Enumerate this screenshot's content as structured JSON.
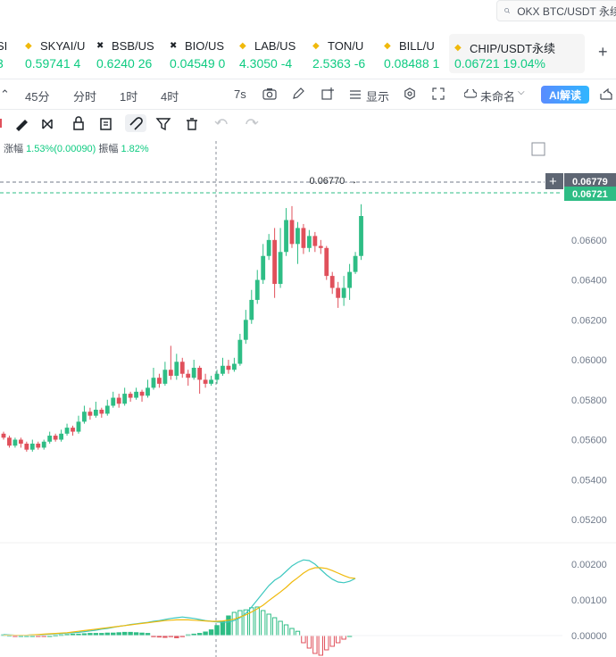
{
  "search": {
    "placeholder": "OKX BTC/USDT 永续"
  },
  "tickers": [
    {
      "name": "SI",
      "price": "3"
    },
    {
      "name": "SKYAI/U",
      "price": "0.59741 4"
    },
    {
      "name": "BSB/US",
      "price": "0.6240 26"
    },
    {
      "name": "BIO/US",
      "price": "0.04549 0"
    },
    {
      "name": "LAB/US",
      "price": "4.3050 -4"
    },
    {
      "name": "TON/U",
      "price": "2.5363 -6"
    },
    {
      "name": "BILL/U",
      "price": "0.08488 1"
    },
    {
      "name": "CHIP/USDT永续",
      "price": "0.06721  19.04%"
    }
  ],
  "toolbar": {
    "intervals": [
      "45分",
      "分时",
      "1时",
      "4时"
    ],
    "seconds": "7s",
    "display_label": "显示",
    "layout_name": "未命名",
    "ai_label": "AI解读"
  },
  "stats": {
    "change_label": "涨幅",
    "change_value": "1.53%(0.00090)",
    "amplitude_label": "振幅",
    "amplitude_value": "1.82%"
  },
  "chart_data": {
    "type": "candlestick",
    "price_axis_ticks": [
      "0.06600",
      "0.06400",
      "0.06200",
      "0.06000",
      "0.05800",
      "0.05600",
      "0.05400",
      "0.05200"
    ],
    "macd_axis_ticks": [
      "0.00200",
      "0.00100",
      "0.00000"
    ],
    "high_marker": "0.06770",
    "crosshair_price": "0.06779",
    "last_price": "0.06721",
    "candles": [
      [
        0.0563,
        0.0561,
        0.0564,
        0.056
      ],
      [
        0.0561,
        0.0557,
        0.0562,
        0.0556
      ],
      [
        0.0557,
        0.056,
        0.0561,
        0.0556
      ],
      [
        0.056,
        0.0558,
        0.0561,
        0.0556
      ],
      [
        0.0558,
        0.0555,
        0.0559,
        0.0554
      ],
      [
        0.0555,
        0.0558,
        0.056,
        0.0554
      ],
      [
        0.0558,
        0.0556,
        0.0559,
        0.0555
      ],
      [
        0.0556,
        0.0559,
        0.056,
        0.0555
      ],
      [
        0.0559,
        0.0562,
        0.0564,
        0.0558
      ],
      [
        0.0562,
        0.056,
        0.0563,
        0.0559
      ],
      [
        0.056,
        0.0563,
        0.0565,
        0.0559
      ],
      [
        0.0563,
        0.0566,
        0.0568,
        0.0562
      ],
      [
        0.0566,
        0.0564,
        0.0567,
        0.0562
      ],
      [
        0.0564,
        0.0569,
        0.0572,
        0.0563
      ],
      [
        0.0569,
        0.0574,
        0.0577,
        0.0568
      ],
      [
        0.0574,
        0.0572,
        0.0576,
        0.057
      ],
      [
        0.0572,
        0.0575,
        0.0579,
        0.0571
      ],
      [
        0.0575,
        0.0573,
        0.0576,
        0.0571
      ],
      [
        0.0573,
        0.0577,
        0.058,
        0.0572
      ],
      [
        0.0577,
        0.0581,
        0.0584,
        0.0576
      ],
      [
        0.0581,
        0.0578,
        0.0583,
        0.0576
      ],
      [
        0.0578,
        0.0583,
        0.0586,
        0.0577
      ],
      [
        0.0583,
        0.0581,
        0.0584,
        0.0579
      ],
      [
        0.0581,
        0.0584,
        0.0586,
        0.058
      ],
      [
        0.0584,
        0.0582,
        0.0585,
        0.0579
      ],
      [
        0.0582,
        0.0586,
        0.059,
        0.0581
      ],
      [
        0.0586,
        0.0591,
        0.0596,
        0.0585
      ],
      [
        0.0591,
        0.0588,
        0.0593,
        0.0586
      ],
      [
        0.0588,
        0.0595,
        0.0599,
        0.0587
      ],
      [
        0.0595,
        0.0592,
        0.0607,
        0.059
      ],
      [
        0.0592,
        0.0599,
        0.0603,
        0.059
      ],
      [
        0.0599,
        0.0593,
        0.0601,
        0.0591
      ],
      [
        0.0593,
        0.0591,
        0.0595,
        0.0587
      ],
      [
        0.0591,
        0.0596,
        0.06,
        0.059
      ],
      [
        0.0596,
        0.059,
        0.0597,
        0.0583
      ],
      [
        0.059,
        0.0588,
        0.0593,
        0.0586
      ],
      [
        0.0588,
        0.059,
        0.0592,
        0.0587
      ],
      [
        0.059,
        0.0593,
        0.0595,
        0.0588
      ],
      [
        0.0593,
        0.0597,
        0.0601,
        0.0592
      ],
      [
        0.0597,
        0.0595,
        0.06,
        0.0593
      ],
      [
        0.0595,
        0.0598,
        0.0601,
        0.0594
      ],
      [
        0.0598,
        0.061,
        0.0613,
        0.0597
      ],
      [
        0.061,
        0.062,
        0.0625,
        0.0608
      ],
      [
        0.062,
        0.063,
        0.0635,
        0.0618
      ],
      [
        0.063,
        0.064,
        0.0645,
        0.0628
      ],
      [
        0.064,
        0.0652,
        0.0658,
        0.0638
      ],
      [
        0.0652,
        0.066,
        0.0663,
        0.065
      ],
      [
        0.066,
        0.0638,
        0.0666,
        0.0631
      ],
      [
        0.0638,
        0.0654,
        0.0666,
        0.0636
      ],
      [
        0.0654,
        0.067,
        0.0676,
        0.0652
      ],
      [
        0.067,
        0.0658,
        0.0677,
        0.0656
      ],
      [
        0.0658,
        0.0666,
        0.0669,
        0.0648
      ],
      [
        0.0666,
        0.0656,
        0.0668,
        0.0653
      ],
      [
        0.0656,
        0.0662,
        0.0665,
        0.0654
      ],
      [
        0.0662,
        0.0657,
        0.0664,
        0.0654
      ],
      [
        0.0657,
        0.0656,
        0.066,
        0.0653
      ],
      [
        0.0656,
        0.0642,
        0.0657,
        0.064
      ],
      [
        0.0642,
        0.0636,
        0.0644,
        0.0633
      ],
      [
        0.0636,
        0.0631,
        0.0639,
        0.0626
      ],
      [
        0.0631,
        0.0636,
        0.0642,
        0.0627
      ],
      [
        0.0636,
        0.0644,
        0.0648,
        0.063
      ],
      [
        0.0644,
        0.0652,
        0.0654,
        0.0643
      ],
      [
        0.0652,
        0.0672,
        0.06779,
        0.065
      ]
    ],
    "macd": {
      "dif": [
        3e-05,
        2e-05,
        1e-05,
        1e-05,
        1e-05,
        2e-05,
        2e-05,
        3e-05,
        4e-05,
        5e-05,
        6e-05,
        7e-05,
        8e-05,
        9e-05,
        0.00011,
        0.00013,
        0.00015,
        0.00018,
        0.0002,
        0.00023,
        0.00026,
        0.00028,
        0.00031,
        0.00033,
        0.00035,
        0.00037,
        0.0004,
        0.00042,
        0.00045,
        0.00048,
        0.0005,
        0.00052,
        0.0005,
        0.00048,
        0.00045,
        0.00042,
        0.0004,
        0.00038,
        0.00037,
        0.00038,
        0.00042,
        0.0005,
        0.00062,
        0.0008,
        0.001,
        0.0012,
        0.0014,
        0.00155,
        0.00165,
        0.0018,
        0.00195,
        0.00205,
        0.00212,
        0.0021,
        0.002,
        0.00185,
        0.0017,
        0.00158,
        0.0015,
        0.00148,
        0.00152,
        0.0016
      ],
      "dea": [
        1e-05,
        1e-05,
        1e-05,
        1e-05,
        1e-05,
        2e-05,
        3e-05,
        4e-05,
        5e-05,
        6e-05,
        7e-05,
        8e-05,
        0.0001,
        0.00012,
        0.00014,
        0.00016,
        0.00018,
        0.0002,
        0.00022,
        0.00024,
        0.00026,
        0.00028,
        0.0003,
        0.00032,
        0.00034,
        0.00036,
        0.00038,
        0.0004,
        0.00042,
        0.00043,
        0.00044,
        0.00044,
        0.00044,
        0.00043,
        0.00042,
        0.00041,
        0.0004,
        0.0004,
        0.00041,
        0.00043,
        0.00046,
        0.00052,
        0.00058,
        0.00066,
        0.00075,
        0.00085,
        0.00098,
        0.0011,
        0.00122,
        0.00135,
        0.0015,
        0.00162,
        0.00175,
        0.00185,
        0.0019,
        0.0019,
        0.00188,
        0.00182,
        0.00175,
        0.00168,
        0.00162,
        0.0016
      ],
      "hist": [
        2e-05,
        1e-05,
        -1e-05,
        0.0,
        0.0,
        0.0,
        -1e-05,
        -1e-05,
        0.0,
        1e-05,
        2e-05,
        3e-05,
        4e-05,
        4e-05,
        5e-05,
        6e-05,
        6e-05,
        6e-05,
        7e-05,
        7e-05,
        8e-05,
        9e-05,
        9e-05,
        8e-05,
        7e-05,
        6e-05,
        -3e-05,
        -4e-05,
        -5e-05,
        -3e-05,
        -6e-05,
        -3e-05,
        2e-05,
        4e-05,
        6e-05,
        0.0001,
        0.00016,
        0.00028,
        0.0004,
        0.00055,
        0.00065,
        0.0007,
        0.00072,
        0.00078,
        0.0008,
        0.0007,
        0.0006,
        0.0005,
        0.0004,
        0.0003,
        0.0002,
        0.00012,
        -0.0002,
        -0.00035,
        -0.0005,
        -0.00055,
        -0.0004,
        -0.0003,
        -0.0002,
        -0.0001,
        0.0
      ]
    }
  },
  "colors": {
    "up": "#2ebd85",
    "down": "#e0505b",
    "dif": "#3ec8c0",
    "dea": "#f0b90b",
    "accent": "#5a8cff"
  }
}
